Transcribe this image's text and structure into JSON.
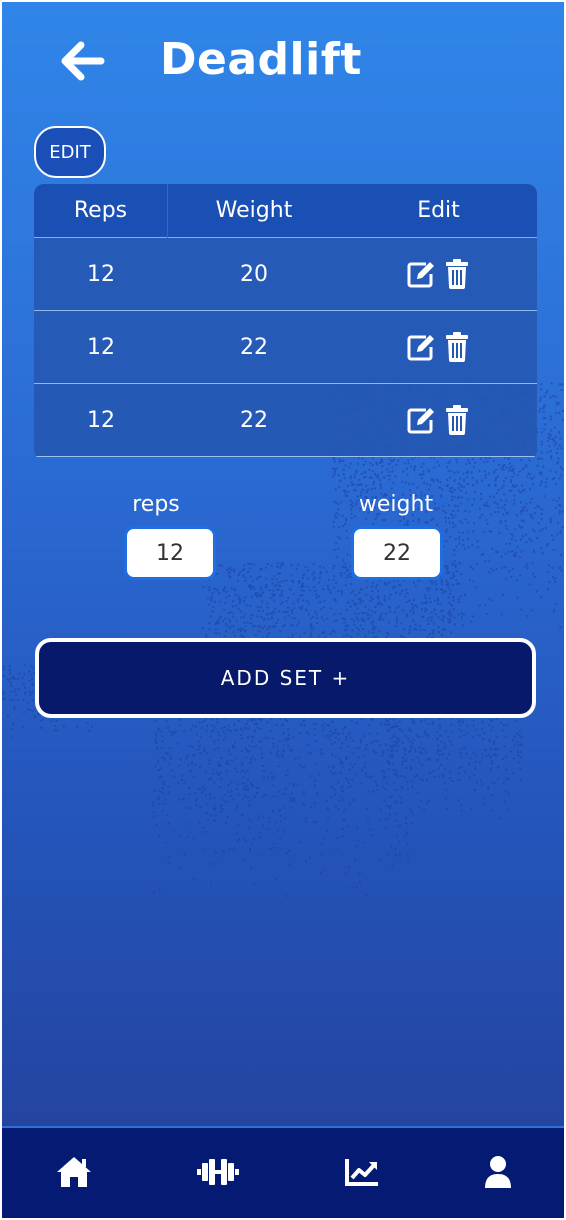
{
  "header": {
    "title": "Deadlift",
    "back_icon": "arrow-left-icon"
  },
  "edit_toggle": {
    "label": "EDIT"
  },
  "table": {
    "columns": [
      "Reps",
      "Weight",
      "Edit"
    ],
    "rows": [
      {
        "reps": "12",
        "weight": "20"
      },
      {
        "reps": "12",
        "weight": "22"
      },
      {
        "reps": "12",
        "weight": "22"
      }
    ],
    "row_action_icons": [
      "edit-icon",
      "trash-icon"
    ]
  },
  "inputs": {
    "reps_label": "reps",
    "reps_value": "12",
    "weight_label": "weight",
    "weight_value": "22"
  },
  "add_set": {
    "label": "ADD SET +"
  },
  "bottom_nav": {
    "items": [
      "home-icon",
      "dumbbell-icon",
      "chart-line-icon",
      "user-icon"
    ]
  },
  "colors": {
    "accent_dark": "#06196b",
    "nav_bg": "#051a72",
    "table_header": "#1a4fb3",
    "input_border": "#1f6fe0"
  }
}
